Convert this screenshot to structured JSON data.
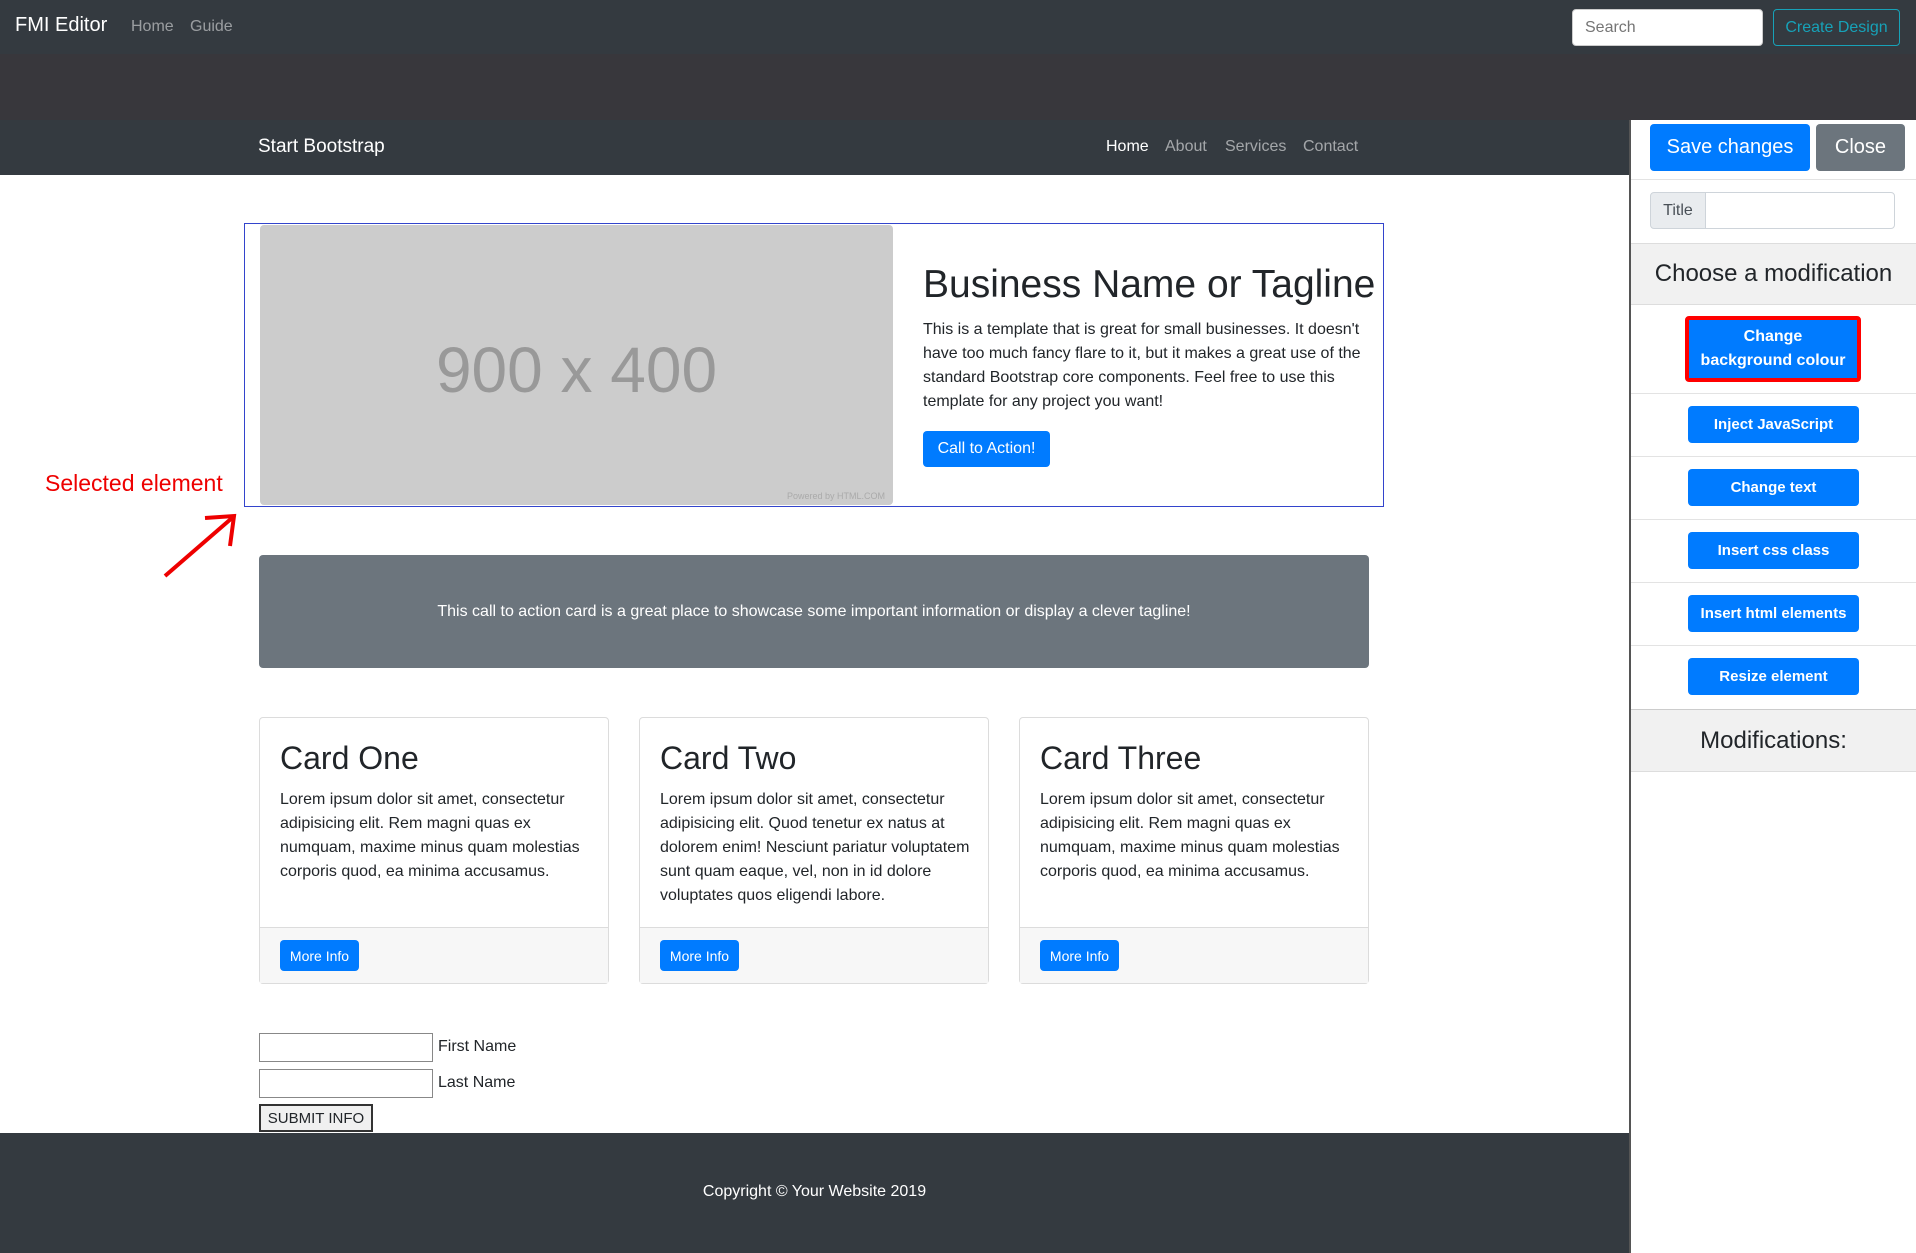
{
  "app": {
    "brand": "FMI Editor",
    "nav": [
      "Home",
      "Guide"
    ],
    "search_placeholder": "Search",
    "create_label": "Create Design"
  },
  "site": {
    "brand": "Start Bootstrap",
    "nav": [
      "Home",
      "About",
      "Services",
      "Contact"
    ],
    "hero": {
      "image_label": "900 x 400",
      "image_credit": "Powered by HTML.COM",
      "title": "Business Name or Tagline",
      "text": "This is a template that is great for small businesses. It doesn't have too much fancy flare to it, but it makes a great use of the standard Bootstrap core components. Feel free to use this template for any project you want!",
      "cta": "Call to Action!"
    },
    "callout": "This call to action card is a great place to showcase some important information or display a clever tagline!",
    "cards": [
      {
        "title": "Card One",
        "text": "Lorem ipsum dolor sit amet, consectetur adipisicing elit. Rem magni quas ex numquam, maxime minus quam molestias corporis quod, ea minima accusamus.",
        "button": "More Info"
      },
      {
        "title": "Card Two",
        "text": "Lorem ipsum dolor sit amet, consectetur adipisicing elit. Quod tenetur ex natus at dolorem enim! Nesciunt pariatur voluptatem sunt quam eaque, vel, non in id dolore voluptates quos eligendi labore.",
        "button": "More Info"
      },
      {
        "title": "Card Three",
        "text": "Lorem ipsum dolor sit amet, consectetur adipisicing elit. Rem magni quas ex numquam, maxime minus quam molestias corporis quod, ea minima accusamus.",
        "button": "More Info"
      }
    ],
    "form": {
      "first_label": "First Name",
      "last_label": "Last Name",
      "submit": "SUBMIT INFO"
    },
    "footer": "Copyright © Your Website 2019"
  },
  "annotation": "Selected element",
  "panel": {
    "save": "Save changes",
    "close": "Close",
    "title_label": "Title",
    "title_value": "",
    "choose_header": "Choose a modification",
    "mods": [
      "Change background colour",
      "Inject JavaScript",
      "Change text",
      "Insert css class",
      "Insert html elements",
      "Resize element"
    ],
    "mods_header": "Modifications:"
  },
  "colors": {
    "primary": "#007bff",
    "dark": "#343a40",
    "secondary": "#6c757d",
    "highlight": "#ff0000"
  }
}
